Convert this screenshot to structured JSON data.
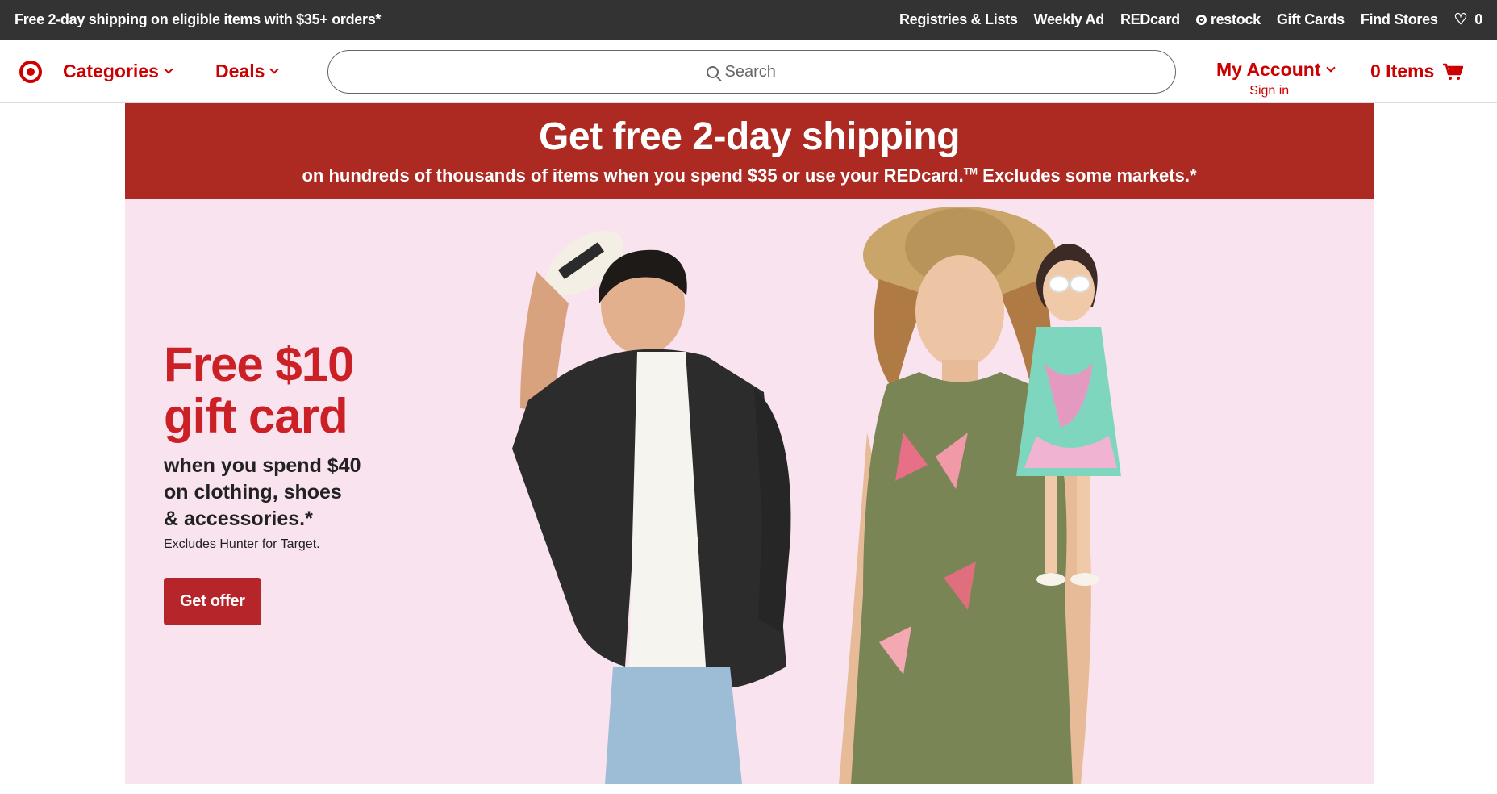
{
  "utility_bar": {
    "promo": "Free 2-day shipping on eligible items with $35+ orders*",
    "links": [
      "Registries & Lists",
      "Weekly Ad",
      "REDcard",
      "restock",
      "Gift Cards",
      "Find Stores"
    ],
    "favorites_count": "0"
  },
  "header": {
    "categories_label": "Categories",
    "deals_label": "Deals",
    "search_placeholder": "Search",
    "account_label": "My Account",
    "sign_in_label": "Sign in",
    "cart_label": "0 Items"
  },
  "shipping_banner": {
    "title": "Get free 2-day shipping",
    "subtitle_pre": "on hundreds of thousands of items when you spend $35 or use your REDcard.",
    "trademark": "TM",
    "subtitle_post": " Excludes some markets.*"
  },
  "hero": {
    "title": "Free $10\ngift card",
    "subtitle": "when you spend $40\non clothing, shoes\n& accessories.*",
    "fine_print": "Excludes Hunter for Target.",
    "cta_label": "Get offer"
  },
  "colors": {
    "brand_red": "#cc0000",
    "banner_red": "#ac2a22",
    "hero_bg": "#f9e3ef",
    "utility_bg": "#333333"
  }
}
